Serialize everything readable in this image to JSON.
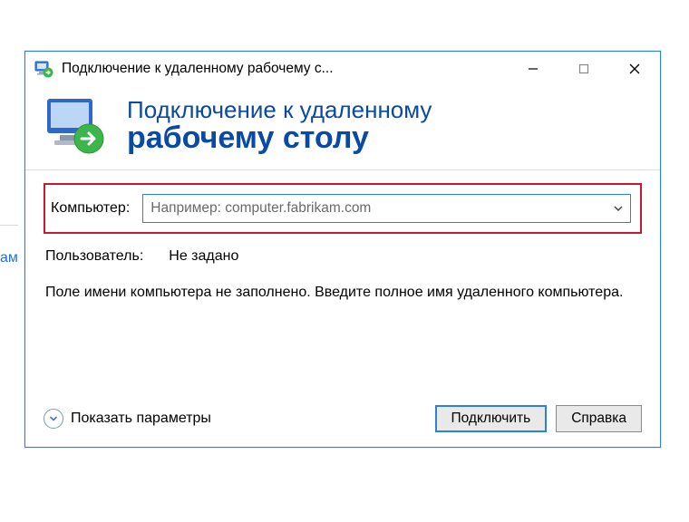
{
  "titlebar": {
    "title": "Подключение к удаленному рабочему с..."
  },
  "banner": {
    "line1": "Подключение к удаленному",
    "line2": "рабочему столу"
  },
  "form": {
    "computer_label": "Компьютер:",
    "computer_placeholder": "Например: computer.fabrikam.com",
    "computer_value": "",
    "user_label": "Пользователь:",
    "user_value": "Не задано",
    "info_text": "Поле имени компьютера не заполнено. Введите полное имя удаленного компьютера."
  },
  "footer": {
    "show_options_label": "Показать параметры",
    "connect_label": "Подключить",
    "help_label": "Справка"
  },
  "background": {
    "peek_text": "ам"
  }
}
